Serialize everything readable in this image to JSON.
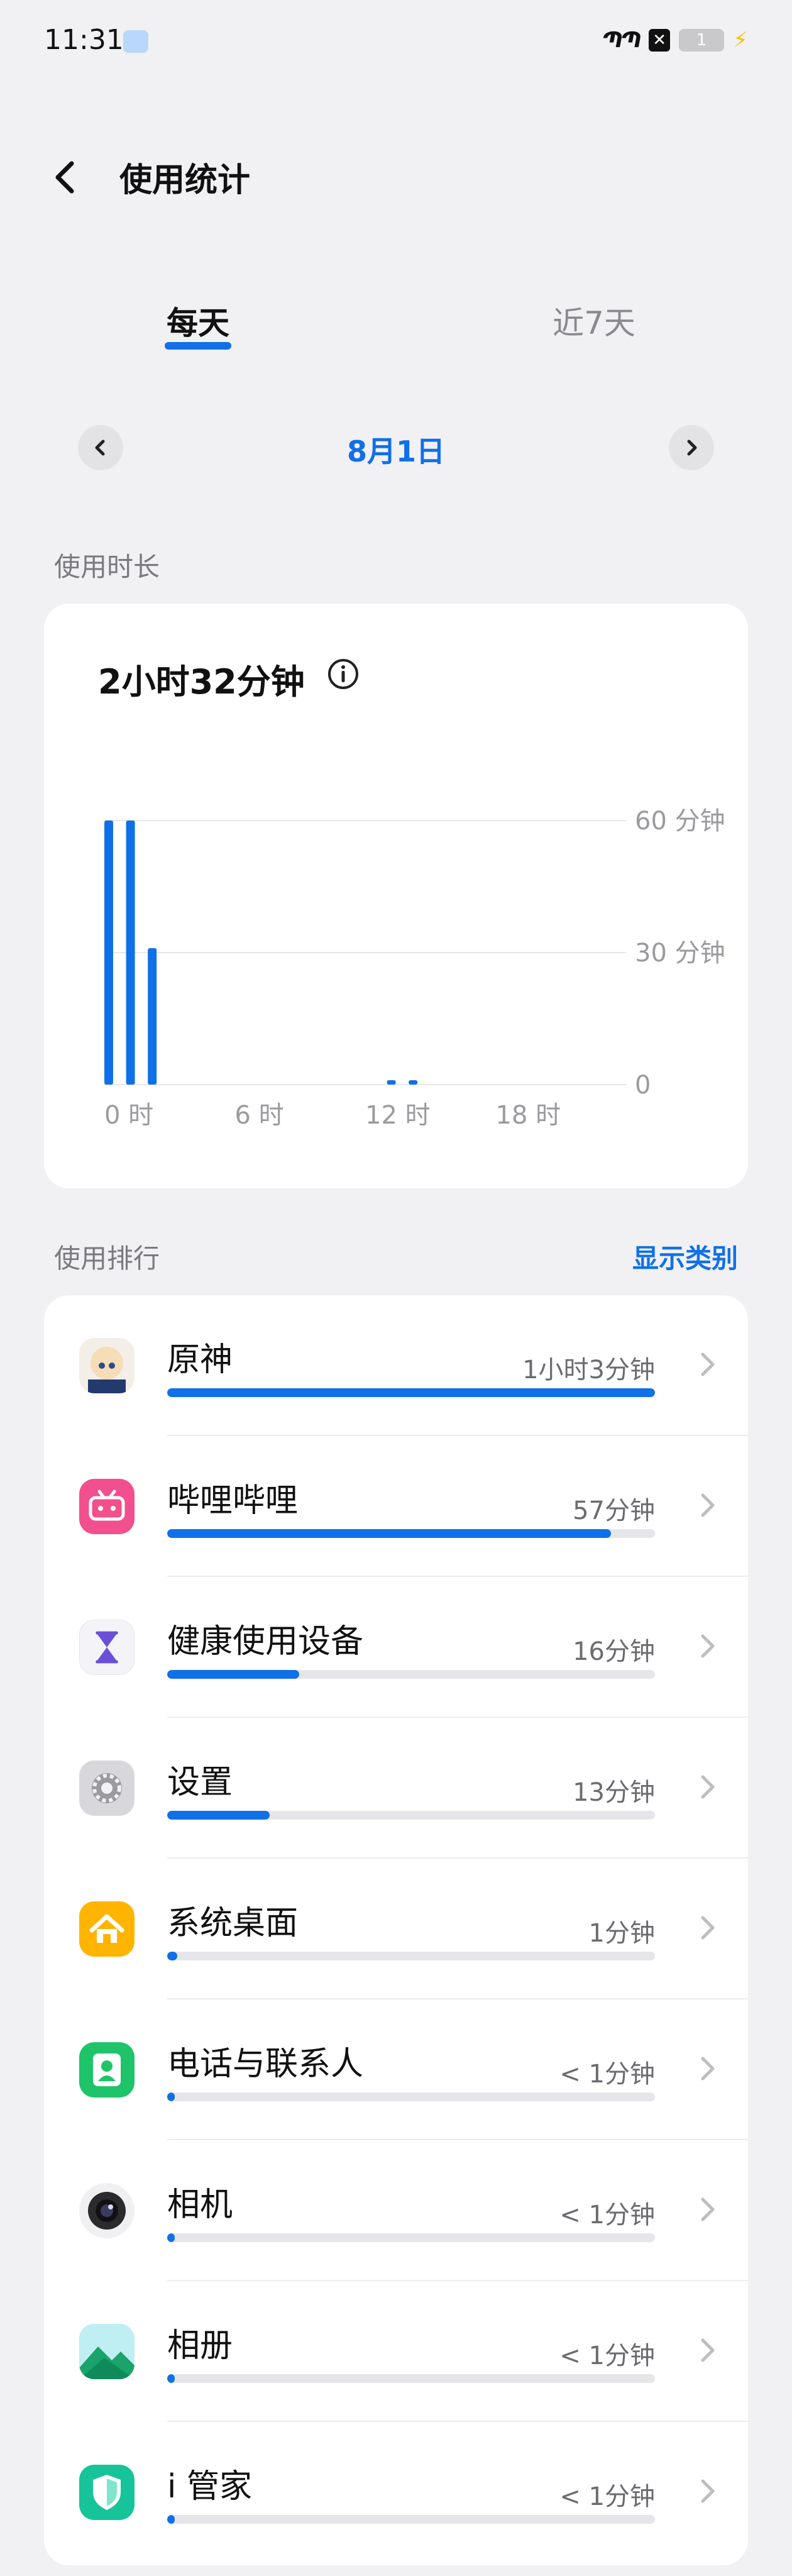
{
  "status_bar": {
    "time": "11:31",
    "signal_text": "ՊՊ",
    "x_badge": "✕",
    "battery_level": "1"
  },
  "header": {
    "title": "使用统计"
  },
  "tabs": [
    {
      "label": "每天",
      "active": true
    },
    {
      "label": "近7天",
      "active": false
    }
  ],
  "date_nav": {
    "date": "8月1日"
  },
  "usage": {
    "section_label": "使用时长",
    "total": "2小时32分钟"
  },
  "chart_data": {
    "type": "bar",
    "title": "",
    "xlabel": "",
    "ylabel": "",
    "ylim": [
      0,
      60
    ],
    "y_ticks": [
      {
        "value": 60,
        "label": "60 分钟"
      },
      {
        "value": 30,
        "label": "30 分钟"
      },
      {
        "value": 0,
        "label": "0"
      }
    ],
    "x_ticks": [
      {
        "hour": 0,
        "label": "0 时"
      },
      {
        "hour": 6,
        "label": "6 时"
      },
      {
        "hour": 12,
        "label": "12 时"
      },
      {
        "hour": 18,
        "label": "18 时"
      }
    ],
    "x_range": [
      0,
      24
    ],
    "bars": [
      {
        "hour": 0,
        "value": 60
      },
      {
        "hour": 1,
        "value": 60
      },
      {
        "hour": 2,
        "value": 31
      },
      {
        "hour": 13,
        "value": 1
      },
      {
        "hour": 14,
        "value": 1
      }
    ],
    "bar_color": "#1070e8",
    "grid": true
  },
  "ranking": {
    "section_label": "使用排行",
    "show_category": "显示类别",
    "apps": [
      {
        "name": "原神",
        "time": "1小时3分钟",
        "fraction": 1.0,
        "icon": "genshin-icon"
      },
      {
        "name": "哔哩哔哩",
        "time": "57分钟",
        "fraction": 0.91,
        "icon": "bilibili-icon"
      },
      {
        "name": "健康使用设备",
        "time": "16分钟",
        "fraction": 0.27,
        "icon": "hourglass-icon"
      },
      {
        "name": "设置",
        "time": "13分钟",
        "fraction": 0.21,
        "icon": "settings-gear-icon"
      },
      {
        "name": "系统桌面",
        "time": "1分钟",
        "fraction": 0.02,
        "icon": "home-icon"
      },
      {
        "name": "电话与联系人",
        "time": "< 1分钟",
        "fraction": 0.01,
        "icon": "contacts-icon"
      },
      {
        "name": "相机",
        "time": "< 1分钟",
        "fraction": 0.01,
        "icon": "camera-icon"
      },
      {
        "name": "相册",
        "time": "< 1分钟",
        "fraction": 0.01,
        "icon": "gallery-icon"
      },
      {
        "name": "i 管家",
        "time": "< 1分钟",
        "fraction": 0.01,
        "icon": "imanager-icon"
      }
    ]
  },
  "colors": {
    "accent": "#1070e8",
    "background": "#f1f1f3",
    "card": "#ffffff"
  }
}
